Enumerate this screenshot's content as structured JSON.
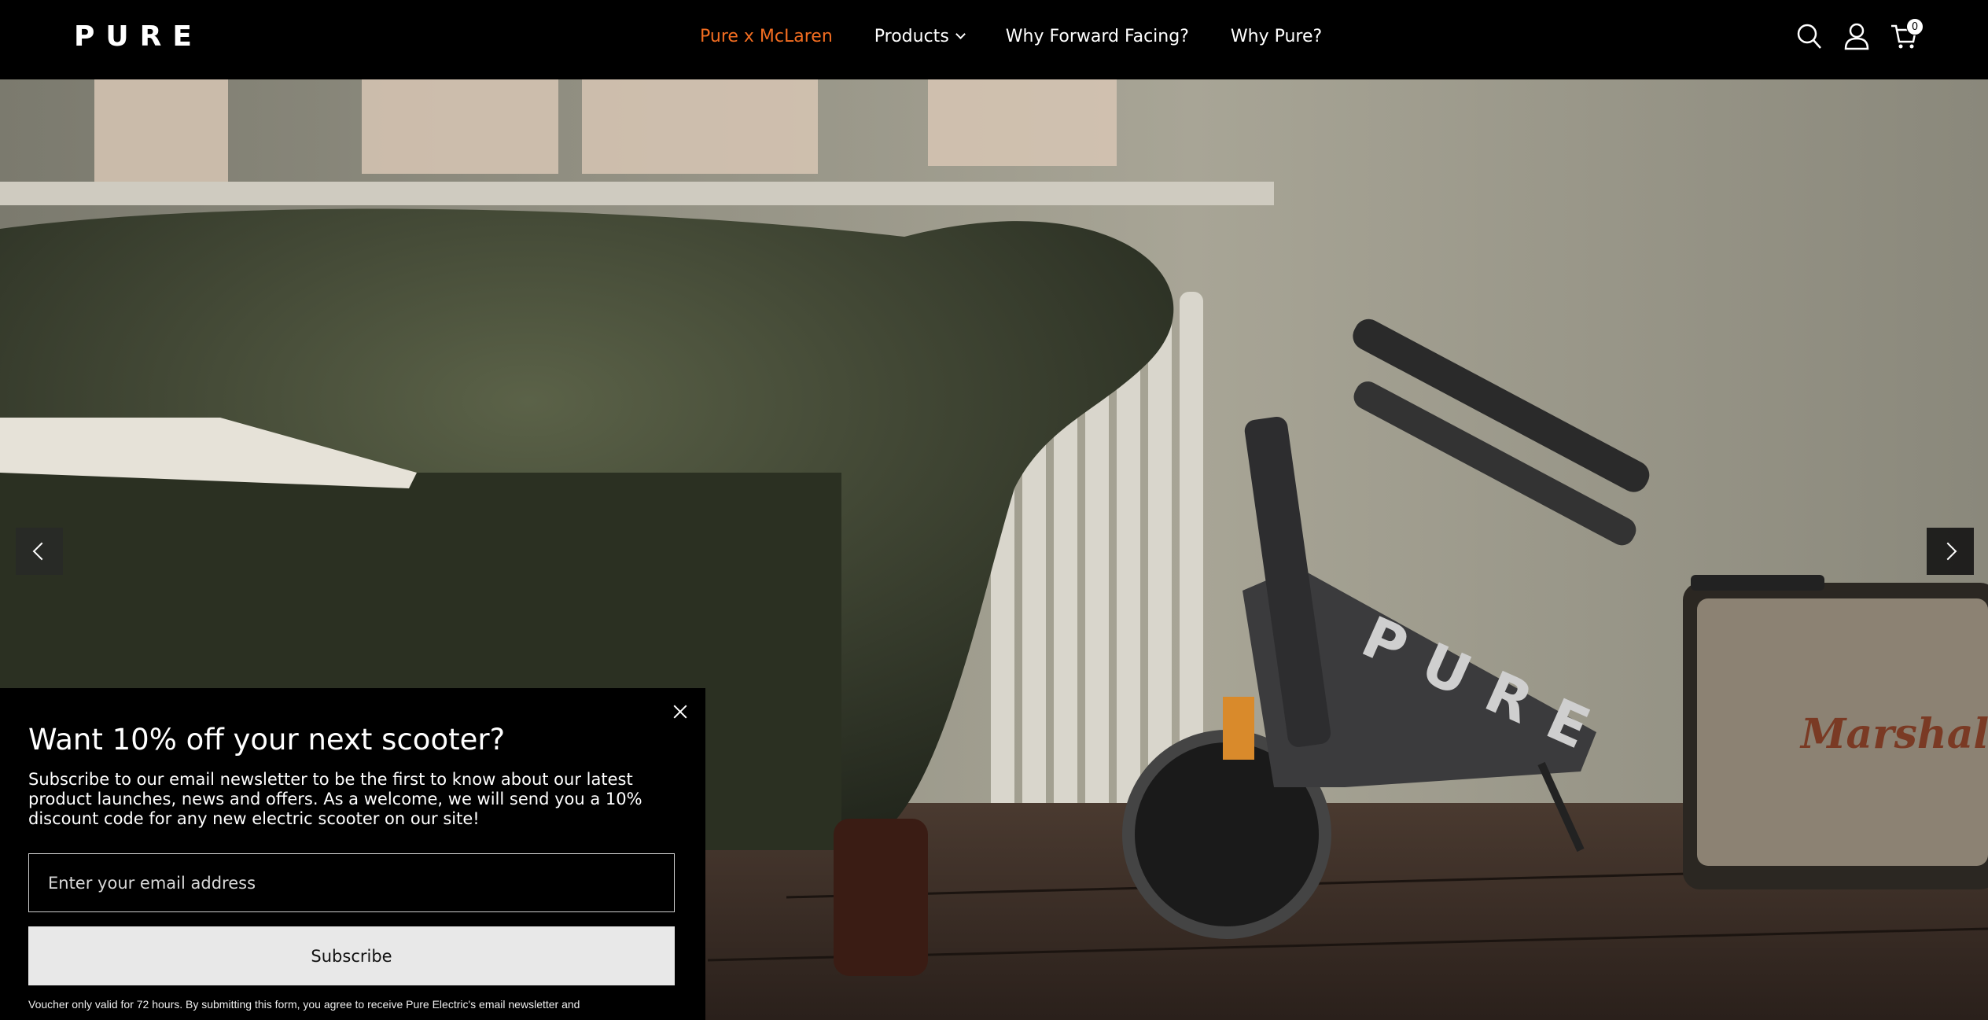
{
  "header": {
    "logo": "PURE",
    "nav": [
      {
        "label": "Pure x McLaren",
        "accent": "#f26d21"
      },
      {
        "label": "Products",
        "has_dropdown": true
      },
      {
        "label": "Why Forward Facing?"
      },
      {
        "label": "Why Pure?"
      }
    ],
    "icons": [
      "search-icon",
      "account-icon",
      "cart-icon"
    ],
    "cart_count": "0"
  },
  "hero": {
    "scooter_branding": "PURE",
    "speaker_branding": "Marshall",
    "controls": [
      "previous-slide",
      "next-slide"
    ]
  },
  "popup": {
    "title": "Want 10% off your next scooter?",
    "text": "Subscribe to our email newsletter to be the first to know about our latest product launches, news and offers. As a welcome, we will send you a 10% discount code for any new electric scooter on our site!",
    "email_placeholder": "Enter your email address",
    "subscribe_label": "Subscribe",
    "fineprint": "Voucher only valid for 72 hours. By submitting this form, you agree to receive Pure Electric's email newsletter and"
  }
}
